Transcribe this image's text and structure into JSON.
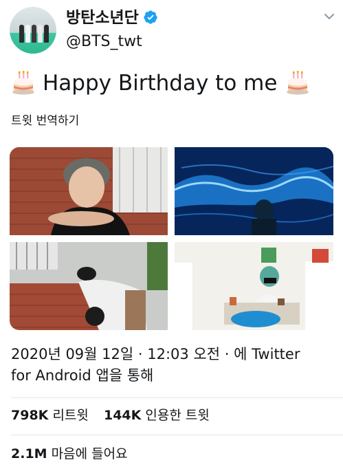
{
  "profile": {
    "display_name": "방탄소년단",
    "handle": "@BTS_twt",
    "verified": true
  },
  "tweet": {
    "text": "Happy Birthday to me",
    "emoji_left": "birthday-cake-icon",
    "emoji_right": "birthday-cake-icon",
    "translate_label": "트윗 번역하기"
  },
  "media": {
    "count": 4
  },
  "meta": {
    "timestamp": "2020년 09월 12일 · 12:03 오전 · 에 Twitter for Android 앱을 통해"
  },
  "stats": {
    "retweets_count": "798K",
    "retweets_label": "리트윗",
    "quotes_count": "144K",
    "quotes_label": "인용한 트윗",
    "likes_count": "2.1M",
    "likes_label": "마음에 들어요"
  },
  "colors": {
    "verified_badge": "#1da1f2",
    "divider": "#e1e8ed",
    "text": "#14171a"
  }
}
